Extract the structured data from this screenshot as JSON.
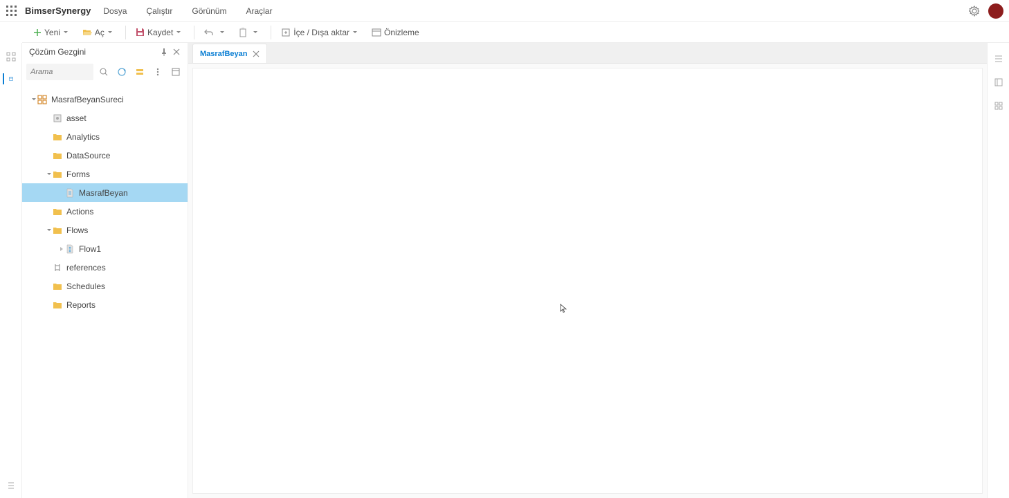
{
  "app": {
    "brand": "BimserSynergy"
  },
  "menu": {
    "file": "Dosya",
    "run": "Çalıştır",
    "view": "Görünüm",
    "tools": "Araçlar"
  },
  "toolbar": {
    "new": "Yeni",
    "open": "Aç",
    "save": "Kaydet",
    "import_export": "İçe / Dışa aktar",
    "preview": "Önizleme"
  },
  "sidebar": {
    "title": "Çözüm Gezgini",
    "search_placeholder": "Arama"
  },
  "tree": {
    "root": "MasrafBeyanSureci",
    "asset": "asset",
    "analytics": "Analytics",
    "datasource": "DataSource",
    "forms": "Forms",
    "form_masrafbeyan": "MasrafBeyan",
    "actions": "Actions",
    "flows": "Flows",
    "flow1": "Flow1",
    "references": "references",
    "schedules": "Schedules",
    "reports": "Reports"
  },
  "tabs": {
    "active": "MasrafBeyan"
  }
}
